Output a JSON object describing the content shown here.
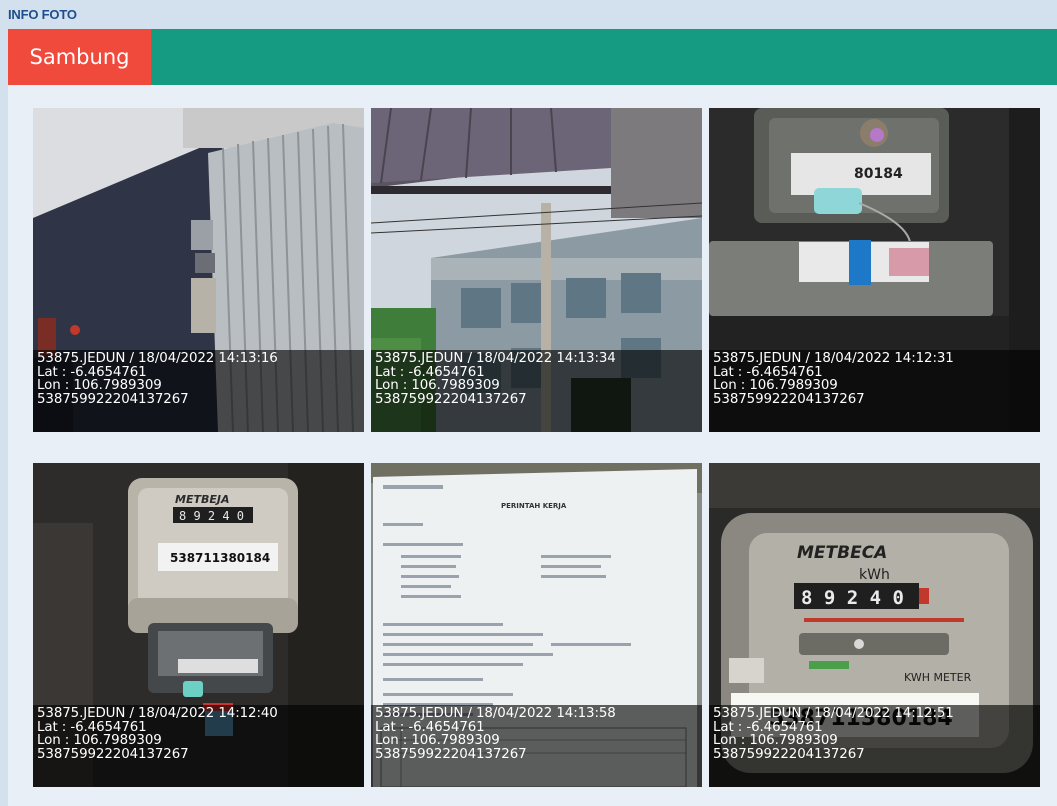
{
  "section": {
    "title": "INFO FOTO"
  },
  "tabs": [
    {
      "label": "Sambung",
      "active": true
    }
  ],
  "colors": {
    "tab_active": "#ef4a3c",
    "tabbar": "#159b82",
    "title": "#1f4e8c"
  },
  "photos": [
    {
      "scene": "wall-meter-scene",
      "caption": {
        "stamp": "53875.JEDUN / 18/04/2022 14:13:16",
        "lat": "Lat : -6.4654761",
        "lon": "Lon : 106.7989309",
        "id": "538759922204137267"
      }
    },
    {
      "scene": "building-pole-scene",
      "caption": {
        "stamp": "53875.JEDUN / 18/04/2022 14:13:34",
        "lat": "Lat : -6.4654761",
        "lon": "Lon : 106.7989309",
        "id": "538759922204137267"
      }
    },
    {
      "scene": "breaker-scene",
      "seal_text": "80184",
      "caption": {
        "stamp": "53875.JEDUN / 18/04/2022 14:12:31",
        "lat": "Lat : -6.4654761",
        "lon": "Lon : 106.7989309",
        "id": "538759922204137267"
      }
    },
    {
      "scene": "meter-box-scene",
      "meter_brand": "METBEJA",
      "meter_reading": "8 9 2 4 0",
      "meter_number": "538711380184",
      "caption": {
        "stamp": "53875.JEDUN / 18/04/2022 14:12:40",
        "lat": "Lat : -6.4654761",
        "lon": "Lon : 106.7989309",
        "id": "538759922204137267"
      }
    },
    {
      "scene": "work-order-document-scene",
      "doc_title": "PERINTAH KERJA",
      "caption": {
        "stamp": "53875.JEDUN / 18/04/2022 14:13:58",
        "lat": "Lat : -6.4654761",
        "lon": "Lon : 106.7989309",
        "id": "538759922204137267"
      }
    },
    {
      "scene": "kwh-meter-closeup-scene",
      "meter_brand": "METBECA",
      "meter_reading": "8 9 2 4 0",
      "meter_unit": "kWh",
      "meter_label": "KWH METER",
      "meter_number": "538711380184",
      "caption": {
        "stamp": "53875.JEDUN / 18/04/2022 14:12:51",
        "lat": "Lat : -6.4654761",
        "lon": "Lon : 106.7989309",
        "id": "538759922204137267"
      }
    }
  ]
}
